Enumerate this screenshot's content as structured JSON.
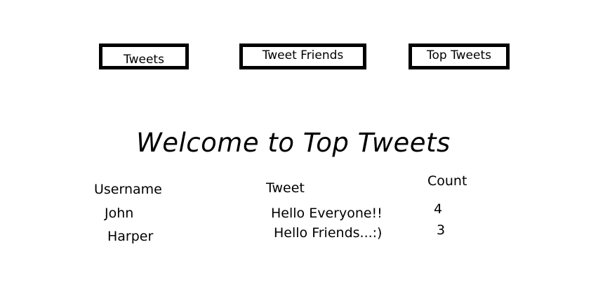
{
  "nav": {
    "tweets_label": "Tweets",
    "tweet_friends_label": "Tweet Friends",
    "top_tweets_label": "Top Tweets"
  },
  "page": {
    "heading": "Welcome to Top Tweets"
  },
  "table": {
    "headers": {
      "username": "Username",
      "tweet": "Tweet",
      "count": "Count"
    },
    "rows": [
      {
        "username": "John",
        "tweet": "Hello Everyone!!",
        "count": "4"
      },
      {
        "username": "Harper",
        "tweet": "Hello Friends...:)",
        "count": "3"
      }
    ]
  },
  "colors": {
    "border": "#000000",
    "background": "#ffffff",
    "text": "#000000"
  }
}
